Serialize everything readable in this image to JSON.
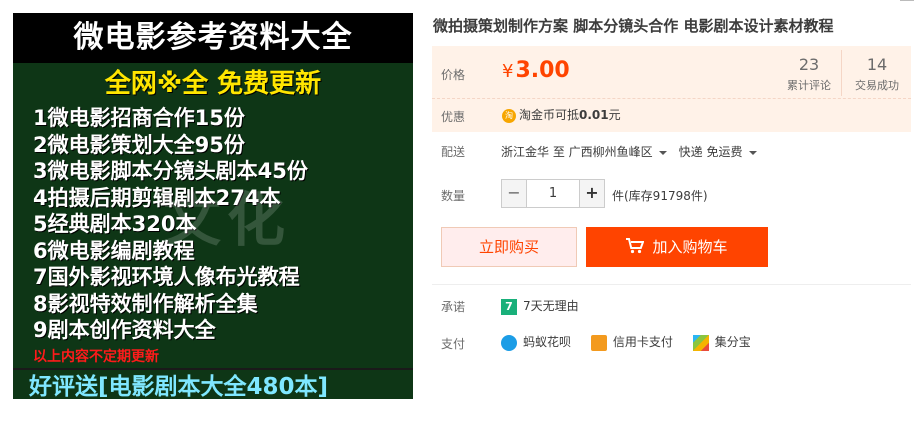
{
  "image": {
    "header": "微电影参考资料大全",
    "subheader": "全网※全  免费更新",
    "items": [
      "1微电影招商合作15份",
      "2微电影策划大全95份",
      "3微电影脚本分镜头剧本45份",
      "4拍摄后期剪辑剧本274本",
      "5经典剧本320本",
      "6微电影编剧教程",
      "7国外影视环境人像布光教程",
      "8影视特效制作解析全集",
      "9剧本创作资料大全"
    ],
    "note": "以上内容不定期更新",
    "watermark": "文化",
    "footer": "好评送[电影剧本大全480本]"
  },
  "title": "微拍摄策划制作方案 脚本分镜头合作 电影剧本设计素材教程",
  "price": {
    "label": "价格",
    "currency": "¥",
    "value": "3.00",
    "reviews_count": "23",
    "reviews_label": "累计评论",
    "sales_count": "14",
    "sales_label": "交易成功"
  },
  "promo": {
    "label": "优惠",
    "icon": "淘",
    "text_prefix": "淘金币可抵",
    "amount": "0.01",
    "text_suffix": "元"
  },
  "shipping": {
    "label": "配送",
    "origin": "浙江金华 至",
    "destination": "广西柳州鱼峰区",
    "method": "快递 免运费"
  },
  "quantity": {
    "label": "数量",
    "minus": "−",
    "value": "1",
    "plus": "+",
    "stock": "件(库存91798件)"
  },
  "actions": {
    "buy_now": "立即购买",
    "add_to_cart": "加入购物车"
  },
  "promise": {
    "label": "承诺",
    "badge": "7",
    "text": "7天无理由"
  },
  "payment": {
    "label": "支付",
    "methods": [
      "蚂蚁花呗",
      "信用卡支付",
      "集分宝"
    ]
  },
  "colors": {
    "accent": "#ff4400",
    "price_bg": "#fff2e8",
    "image_bg": "#0e3616"
  }
}
